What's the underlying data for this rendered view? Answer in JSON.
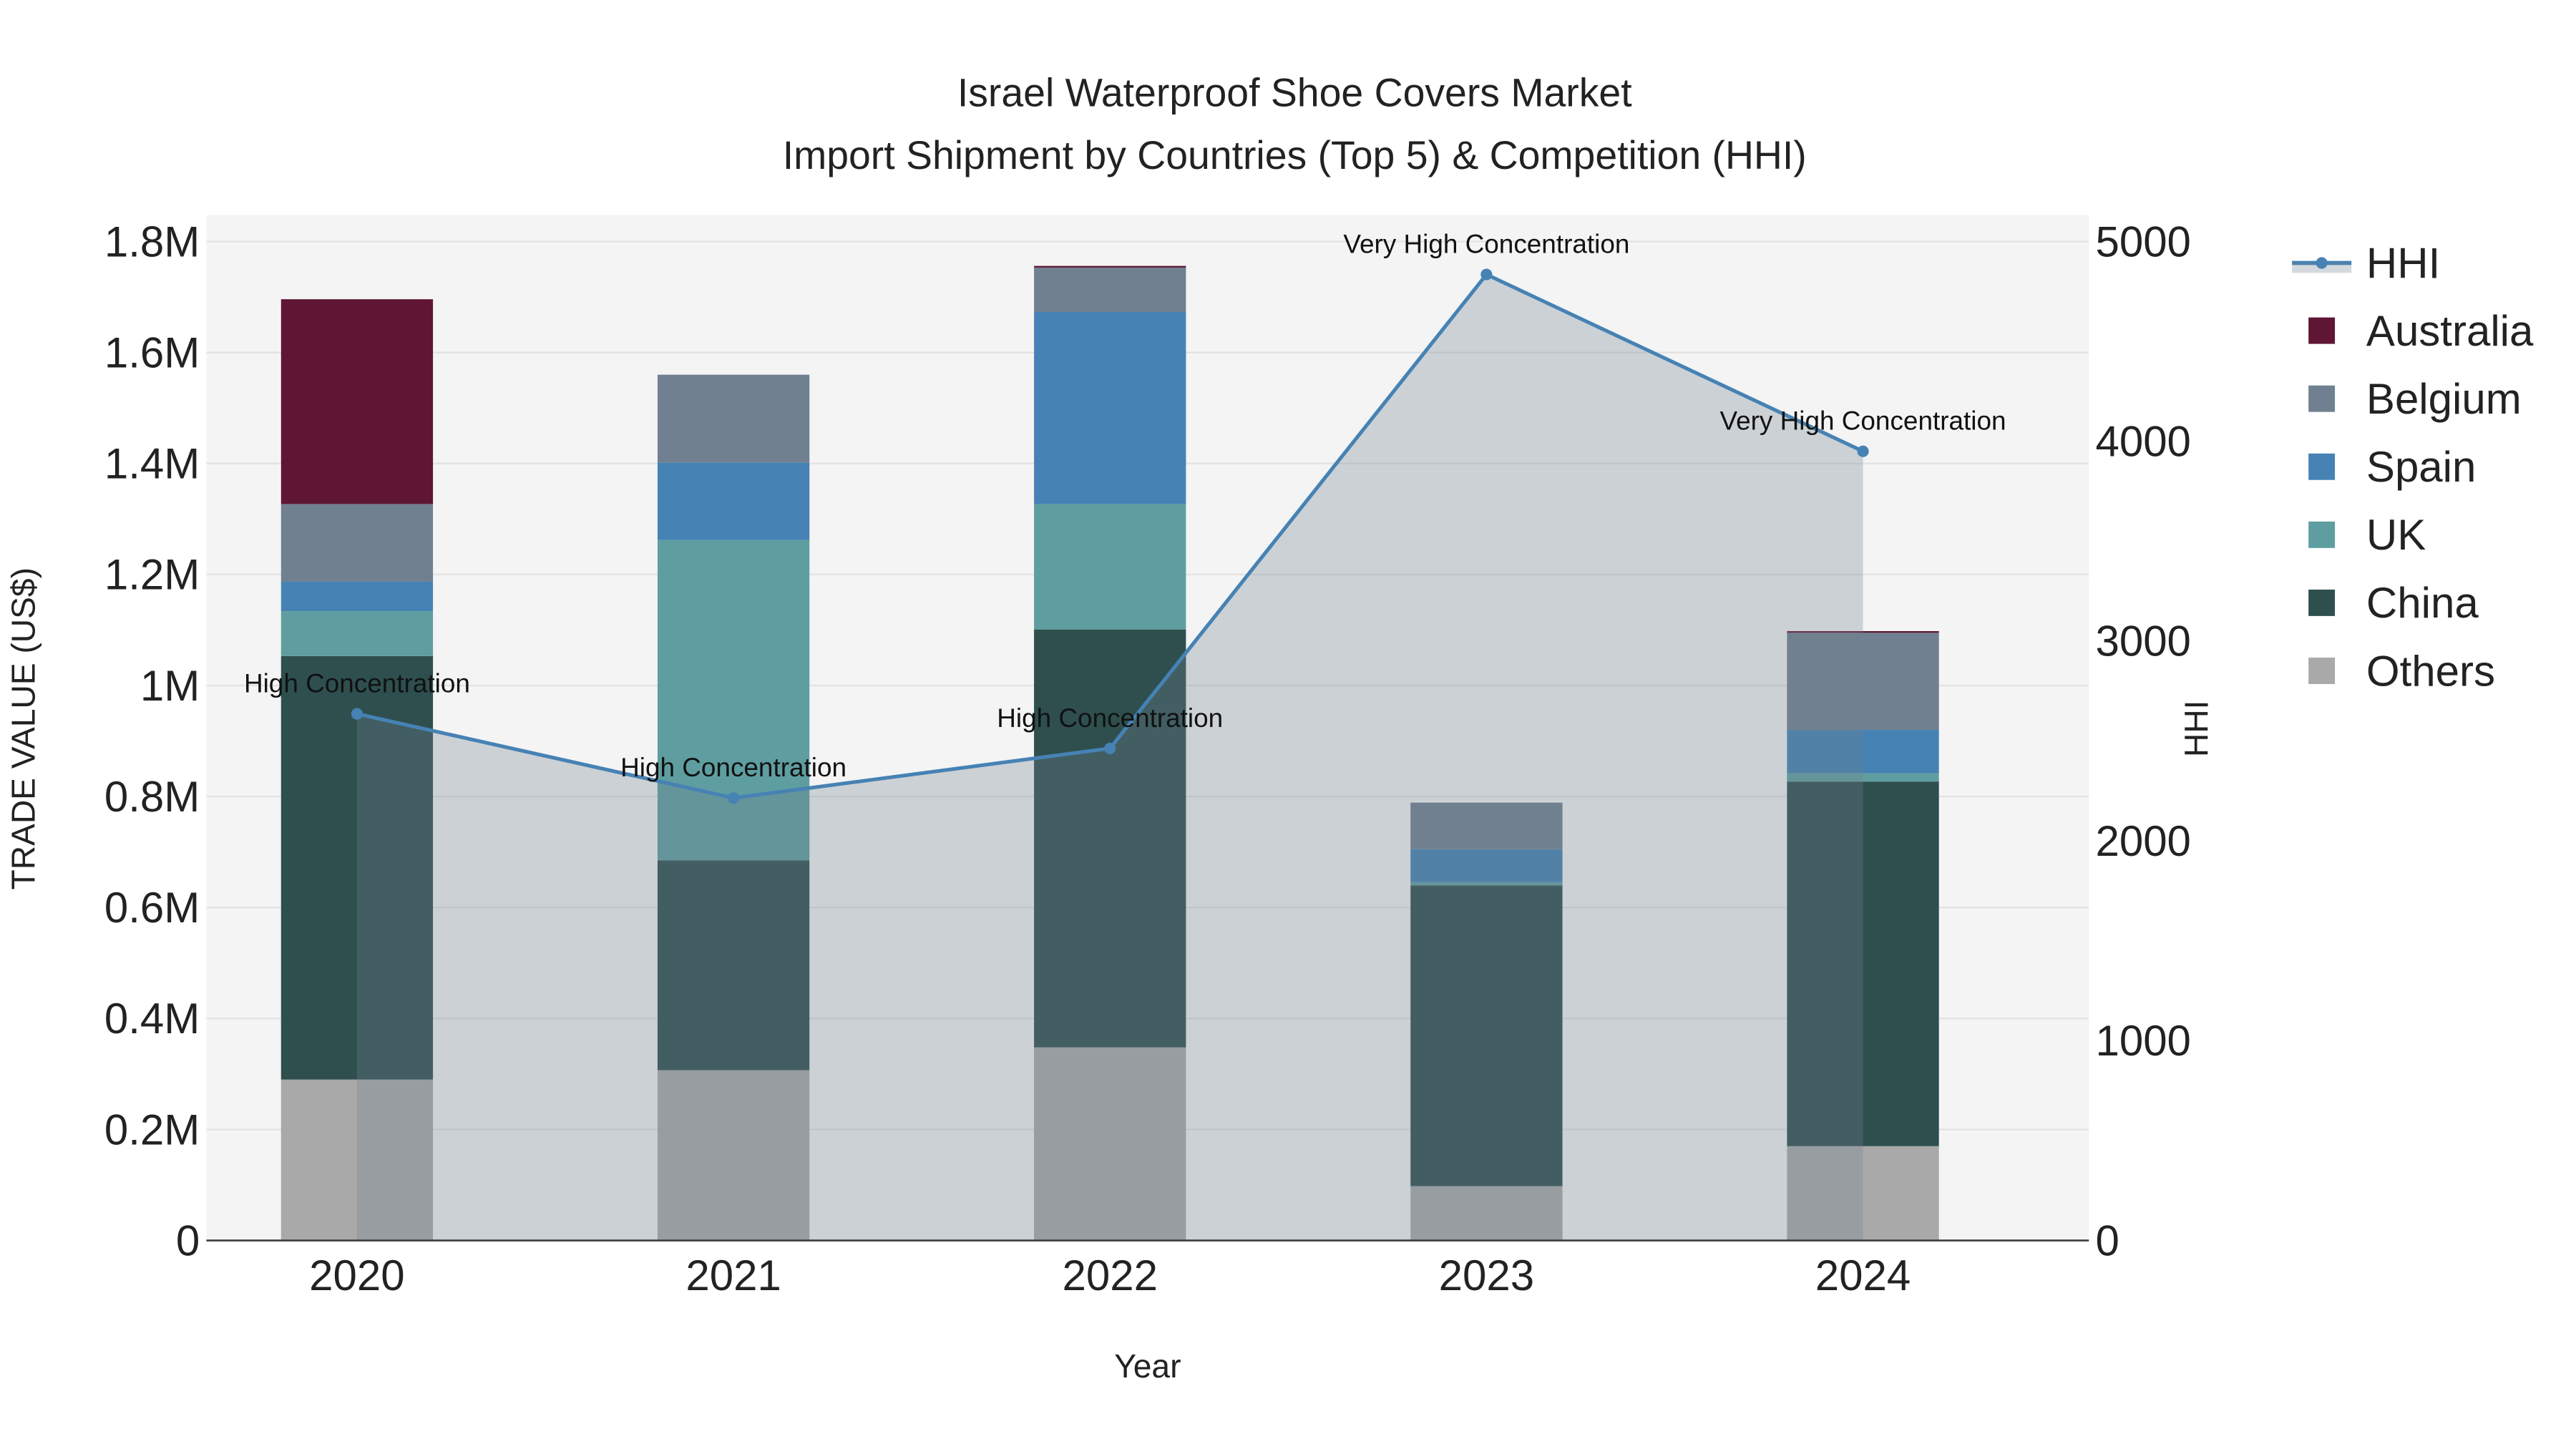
{
  "chart_data": {
    "type": "bar",
    "barmode": "stack",
    "title": "Israel Waterproof Shoe Covers Market",
    "subtitle": "Import Shipment by Countries (Top 5) & Competition (HHI)",
    "xlabel": "Year",
    "ylabel": "TRADE VALUE (US$)",
    "y2label": "HHI",
    "categories": [
      "2020",
      "2021",
      "2022",
      "2023",
      "2024"
    ],
    "ylim": [
      0,
      1800000
    ],
    "y2lim": [
      0,
      5000
    ],
    "yticks": [
      0,
      200000,
      400000,
      600000,
      800000,
      1000000,
      1200000,
      1400000,
      1600000,
      1800000
    ],
    "ytick_labels": [
      "0",
      "0.2M",
      "0.4M",
      "0.6M",
      "0.8M",
      "1M",
      "1.2M",
      "1.4M",
      "1.6M",
      "1.8M"
    ],
    "y2ticks": [
      0,
      1000,
      2000,
      3000,
      4000,
      5000
    ],
    "y2tick_labels": [
      "0",
      "1000",
      "2000",
      "3000",
      "4000",
      "5000"
    ],
    "grid": true,
    "legend_placement": "right",
    "series": [
      {
        "name": "Others",
        "color": "#a9a9a9",
        "values": [
          290000,
          307000,
          348000,
          98000,
          170000
        ]
      },
      {
        "name": "China",
        "color": "#2f4f4f",
        "values": [
          763000,
          378000,
          753000,
          542000,
          657000
        ]
      },
      {
        "name": "UK",
        "color": "#5f9ea0",
        "values": [
          81000,
          577000,
          226000,
          6000,
          15000
        ]
      },
      {
        "name": "Spain",
        "color": "#4682b4",
        "values": [
          53000,
          140000,
          346000,
          59000,
          78000
        ]
      },
      {
        "name": "Belgium",
        "color": "#708090",
        "values": [
          140000,
          158000,
          80000,
          84000,
          175000
        ]
      },
      {
        "name": "Australia",
        "color": "#5e1634",
        "values": [
          369000,
          0,
          3000,
          0,
          3000
        ]
      }
    ],
    "hhi": {
      "name": "HHI",
      "color": "#4682b4",
      "values": [
        2636,
        2215,
        2463,
        4835,
        3950
      ],
      "annotations": [
        "High Concentration",
        "High Concentration",
        "High Concentration",
        "Very High Concentration",
        "Very High Concentration"
      ]
    },
    "legend_order": [
      "HHI",
      "Australia",
      "Belgium",
      "Spain",
      "UK",
      "China",
      "Others"
    ]
  }
}
